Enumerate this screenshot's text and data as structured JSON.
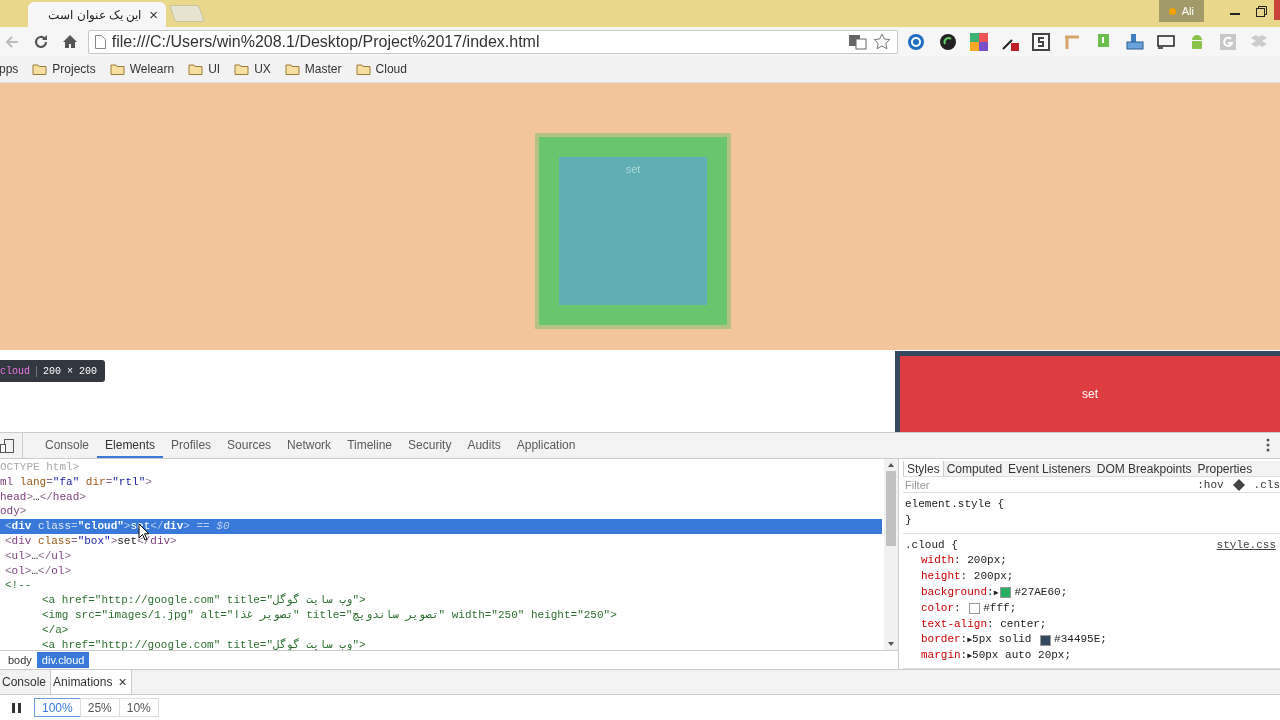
{
  "browser": {
    "tab_title": "این یک عنوان است",
    "tab_close": "×",
    "profile": "Ali",
    "url": "file:///C:/Users/win%208.1/Desktop/Project%2017/index.html",
    "bookmarks": [
      {
        "label": "pps",
        "kind": "apps"
      },
      {
        "label": "Projects",
        "kind": "folder"
      },
      {
        "label": "Welearn",
        "kind": "folder"
      },
      {
        "label": "UI",
        "kind": "folder"
      },
      {
        "label": "UX",
        "kind": "folder"
      },
      {
        "label": "Master",
        "kind": "folder"
      },
      {
        "label": "Cloud",
        "kind": "folder"
      }
    ]
  },
  "page": {
    "cloud": {
      "text": "set"
    },
    "box": {
      "text": "set"
    },
    "inspect_tooltip": {
      "selector": "cloud",
      "size": "200 × 200"
    }
  },
  "devtools": {
    "tabs": [
      {
        "label": "Console",
        "selected": false
      },
      {
        "label": "Elements",
        "selected": true
      },
      {
        "label": "Profiles",
        "selected": false
      },
      {
        "label": "Sources",
        "selected": false
      },
      {
        "label": "Network",
        "selected": false
      },
      {
        "label": "Timeline",
        "selected": false
      },
      {
        "label": "Security",
        "selected": false
      },
      {
        "label": "Audits",
        "selected": false
      },
      {
        "label": "Application",
        "selected": false
      }
    ],
    "tree": [
      {
        "selected": false,
        "segments": [
          {
            "kind": "doctype",
            "t": "OCTYPE html>"
          }
        ]
      },
      {
        "selected": false,
        "segments": [
          {
            "kind": "tag",
            "t": "ml"
          },
          {
            "kind": "attr",
            "t": " lang"
          },
          {
            "kind": "punct",
            "t": "="
          },
          {
            "kind": "value",
            "t": "\"fa\""
          },
          {
            "kind": "attr",
            "t": " dir"
          },
          {
            "kind": "punct",
            "t": "="
          },
          {
            "kind": "value",
            "t": "\"rtl\""
          },
          {
            "kind": "punct",
            "t": ">"
          }
        ]
      },
      {
        "selected": false,
        "segments": [
          {
            "kind": "tag",
            "t": "head"
          },
          {
            "kind": "punct",
            "t": ">"
          },
          {
            "kind": "text",
            "t": "…"
          },
          {
            "kind": "punct",
            "t": "</"
          },
          {
            "kind": "tag",
            "t": "head"
          },
          {
            "kind": "punct",
            "t": ">"
          }
        ]
      },
      {
        "selected": false,
        "segments": [
          {
            "kind": "tag",
            "t": "ody"
          },
          {
            "kind": "punct",
            "t": ">"
          }
        ],
        "children": [
          {
            "selected": true,
            "segments": [
              {
                "kind": "punct",
                "t": "<"
              },
              {
                "kind": "tag",
                "t": "div"
              },
              {
                "kind": "attr",
                "t": " class"
              },
              {
                "kind": "punct",
                "t": "="
              },
              {
                "kind": "value",
                "t": "\"cloud\""
              },
              {
                "kind": "punct",
                "t": ">"
              },
              {
                "kind": "text",
                "t": "set"
              },
              {
                "kind": "punct",
                "t": "</"
              },
              {
                "kind": "tag",
                "t": "div"
              },
              {
                "kind": "punct",
                "t": ">"
              },
              {
                "kind": "hint",
                "t": " == $0"
              }
            ]
          },
          {
            "selected": false,
            "segments": [
              {
                "kind": "punct",
                "t": "<"
              },
              {
                "kind": "tag",
                "t": "div"
              },
              {
                "kind": "attr",
                "t": " class"
              },
              {
                "kind": "punct",
                "t": "="
              },
              {
                "kind": "value",
                "t": "\"box\""
              },
              {
                "kind": "punct",
                "t": ">"
              },
              {
                "kind": "text",
                "t": "set"
              },
              {
                "kind": "punct",
                "t": "</"
              },
              {
                "kind": "tag",
                "t": "div"
              },
              {
                "kind": "punct",
                "t": ">"
              }
            ]
          },
          {
            "selected": false,
            "segments": [
              {
                "kind": "punct",
                "t": "<"
              },
              {
                "kind": "tag",
                "t": "ul"
              },
              {
                "kind": "punct",
                "t": ">"
              },
              {
                "kind": "text",
                "t": "…"
              },
              {
                "kind": "punct",
                "t": "</"
              },
              {
                "kind": "tag",
                "t": "ul"
              },
              {
                "kind": "punct",
                "t": ">"
              }
            ]
          },
          {
            "selected": false,
            "segments": [
              {
                "kind": "punct",
                "t": "<"
              },
              {
                "kind": "tag",
                "t": "ol"
              },
              {
                "kind": "punct",
                "t": ">"
              },
              {
                "kind": "text",
                "t": "…"
              },
              {
                "kind": "punct",
                "t": "</"
              },
              {
                "kind": "tag",
                "t": "ol"
              },
              {
                "kind": "punct",
                "t": ">"
              }
            ]
          },
          {
            "selected": false,
            "segments": [
              {
                "kind": "comment",
                "t": "<!--"
              }
            ],
            "children": [
              {
                "selected": false,
                "segments": [
                  {
                    "kind": "comment",
                    "t": "<a href=\"http://google.com\" title=\"وب سایت گوگل\">"
                  }
                ]
              },
              {
                "selected": false,
                "segments": [
                  {
                    "kind": "comment",
                    "t": "<img src=\"images/1.jpg\" alt=\"تصویر غذا\" title=\"تصویر ساندویچ\" width=\"250\" height=\"250\">"
                  }
                ]
              },
              {
                "selected": false,
                "segments": [
                  {
                    "kind": "comment",
                    "t": "</a>"
                  }
                ]
              },
              {
                "selected": false,
                "segments": [
                  {
                    "kind": "comment",
                    "t": "<a href=\"http://google.com\" title=\"وب سایت گوگل\">"
                  }
                ]
              }
            ]
          }
        ]
      }
    ],
    "breadcrumbs": [
      {
        "label": "body",
        "selected": false
      },
      {
        "label": "div.cloud",
        "selected": true
      }
    ],
    "styles_tabs": [
      {
        "label": "Styles",
        "selected": true
      },
      {
        "label": "Computed",
        "selected": false
      },
      {
        "label": "Event Listeners",
        "selected": false
      },
      {
        "label": "DOM Breakpoints",
        "selected": false
      },
      {
        "label": "Properties",
        "selected": false
      }
    ],
    "filter": {
      "placeholder": "Filter"
    },
    "hov": ":hov",
    "cls": ".cls",
    "rules": [
      {
        "selector": "element.style {",
        "close": "}"
      },
      {
        "selector": ".cloud {",
        "source": "style.css",
        "properties": [
          {
            "name": "width",
            "colon": ":",
            "value": "200px;"
          },
          {
            "name": "height",
            "colon": ":",
            "value": "200px;"
          },
          {
            "name": "background",
            "colon": ":",
            "expander": "▶",
            "color": "#27ae60",
            "value": "#27AE60;"
          },
          {
            "name": "color",
            "colon": ":",
            "color": "#ffffff",
            "value": "#fff;"
          },
          {
            "name": "text-align",
            "colon": ":",
            "value": "center;"
          },
          {
            "name": "border",
            "colon": ":",
            "expander": "▶",
            "value": "5px solid",
            "color": "#34495e",
            "value2": "#34495E;"
          },
          {
            "name": "margin",
            "colon": ":",
            "expander": "▶",
            "value": "50px auto 20px;"
          }
        ]
      }
    ],
    "drawer_tabs": [
      {
        "label": "Console",
        "selected": false
      },
      {
        "label": "Animations",
        "selected": true,
        "close": "×"
      }
    ],
    "speeds": [
      {
        "label": "100%",
        "selected": true
      },
      {
        "label": "25%",
        "selected": false
      },
      {
        "label": "10%",
        "selected": false
      }
    ]
  }
}
